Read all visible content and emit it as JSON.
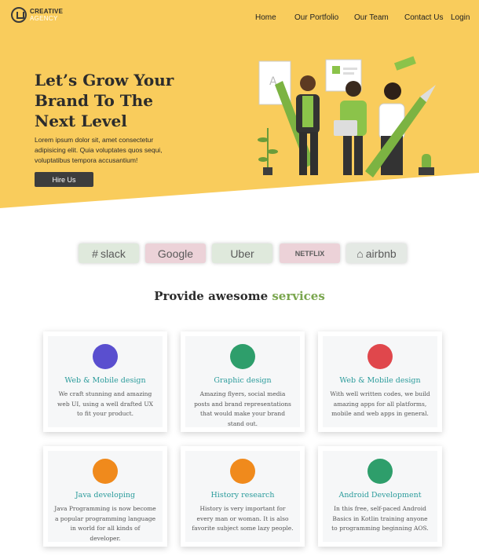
{
  "brand": {
    "line1": "CREATIVE",
    "line2": "AGENCY"
  },
  "nav": [
    "Home",
    "Our Portfolio",
    "Our Team",
    "Contact Us",
    "Login"
  ],
  "hero": {
    "title": "Let’s Grow Your Brand To The Next Level",
    "text": "Lorem ipsum dolor sit, amet consectetur adipisicing elit. Quia voluptates quos sequi, voluptatibus tempora accusantium!",
    "cta": "Hire Us"
  },
  "brands": [
    "slack",
    "Google",
    "Uber",
    "NETFLIX",
    "airbnb"
  ],
  "services_title": {
    "prefix": "Provide awesome ",
    "accent": "services"
  },
  "services": [
    {
      "title": "Web & Mobile design",
      "desc": "We craft stunning and amazing web UI, using a well drafted UX to fit your product.",
      "icon": "mobile-design-icon",
      "color": "#5a4fcf"
    },
    {
      "title": "Graphic design",
      "desc": "Amazing flyers, social media posts and brand representations that would make your brand stand out.",
      "icon": "palette-icon",
      "color": "#2e9e6b"
    },
    {
      "title": "Web & Mobile design",
      "desc": "With well written codes, we build amazing apps for all platforms, mobile and web apps in general.",
      "icon": "monitor-icon",
      "color": "#e0474c"
    },
    {
      "title": "Java developing",
      "desc": "Java Programming is now become a popular programming language in world for all kinds of developer.",
      "icon": "font-icon",
      "color": "#f08a1c"
    },
    {
      "title": "History research",
      "desc": "History is very important for every man or woman. It is also favorite subject some lazy people.",
      "icon": "history-icon",
      "color": "#f08a1c"
    },
    {
      "title": "Android Development",
      "desc": "In this free, self-paced Android Basics in Kotlin training anyone to programming beginning AOS.",
      "icon": "android-icon",
      "color": "#2e9e6b"
    }
  ],
  "colors": {
    "hero_bg": "#f9cc5c",
    "accent_green": "#7aa64e",
    "card_title": "#2a9b9b",
    "button_bg": "#3d3d3d"
  }
}
